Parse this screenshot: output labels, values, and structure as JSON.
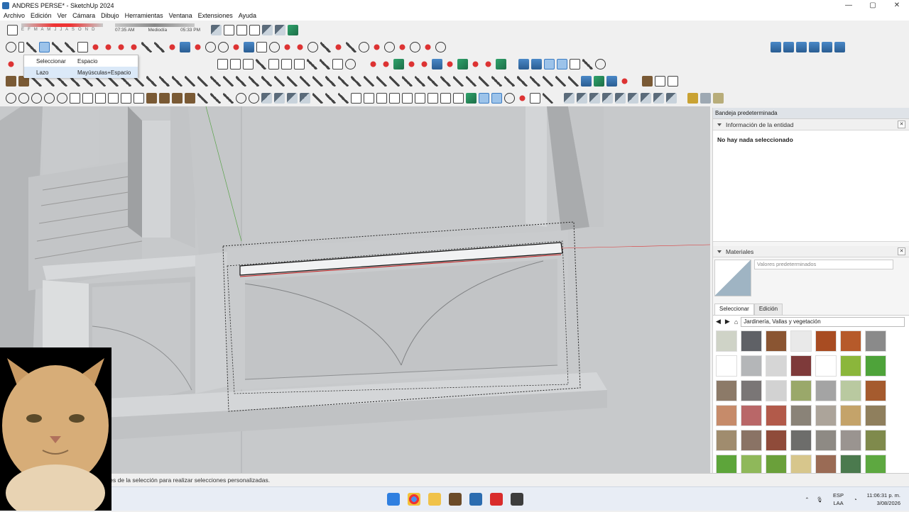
{
  "window": {
    "title": "ANDRES PERSE* - SketchUp 2024",
    "minimize": "—",
    "maximize": "▢",
    "close": "✕"
  },
  "menu": [
    "Archivo",
    "Edición",
    "Ver",
    "Cámara",
    "Dibujo",
    "Herramientas",
    "Ventana",
    "Extensiones",
    "Ayuda"
  ],
  "shadows": {
    "months": "E F M A M J J A S O N D",
    "time_start": "07:35 AM",
    "time_mid": "Mediodía",
    "time_end": "05:33 PM"
  },
  "select_menu": {
    "items": [
      {
        "label": "Seleccionar",
        "shortcut": "Espacio"
      },
      {
        "label": "Lazo",
        "shortcut": "Mayúsculas+Espacio"
      }
    ]
  },
  "tray": {
    "title": "Bandeja predeterminada",
    "entity_info": {
      "title": "Información de la entidad",
      "status": "No hay nada seleccionado"
    },
    "materials": {
      "title": "Materiales",
      "name_placeholder": "Valores predeterminados",
      "tabs": [
        "Seleccionar",
        "Edición"
      ],
      "library": "Jardinería, Vallas y vegetación",
      "swatch_colors": [
        "#cfd3c7",
        "#5f6166",
        "#8a5532",
        "#e9e9e9",
        "#a84c22",
        "#b65a2a",
        "#8a8a8a",
        "#ffffff",
        "#b4b6b8",
        "#d6d6d6",
        "#7e3a3a",
        "#ffffff",
        "#8bb63b",
        "#4ea33a",
        "#8c7a68",
        "#7a7676",
        "#d2d2d2",
        "#9aa86a",
        "#a4a4a4",
        "#b9c9a0",
        "#a55b2e",
        "#c68b6a",
        "#b96768",
        "#b25a4a",
        "#8a8378",
        "#aca49a",
        "#c4a36a",
        "#8f7f5d",
        "#a08c6e",
        "#8a7365",
        "#8f4b3a",
        "#6d6d6b",
        "#8e8a84",
        "#9a9490",
        "#7f8a4c",
        "#5da53a",
        "#8fb85a",
        "#6aa03a",
        "#d7c68c",
        "#9a6b55",
        "#4b7a4e",
        "#5da840"
      ]
    }
  },
  "status_text": "ites de la selección para realizar selecciones personalizadas.",
  "taskbar": {
    "lang_top": "ESP",
    "lang_bot": "LAA",
    "time": "11:06:31 p. m.",
    "date": "3/08/2026"
  }
}
